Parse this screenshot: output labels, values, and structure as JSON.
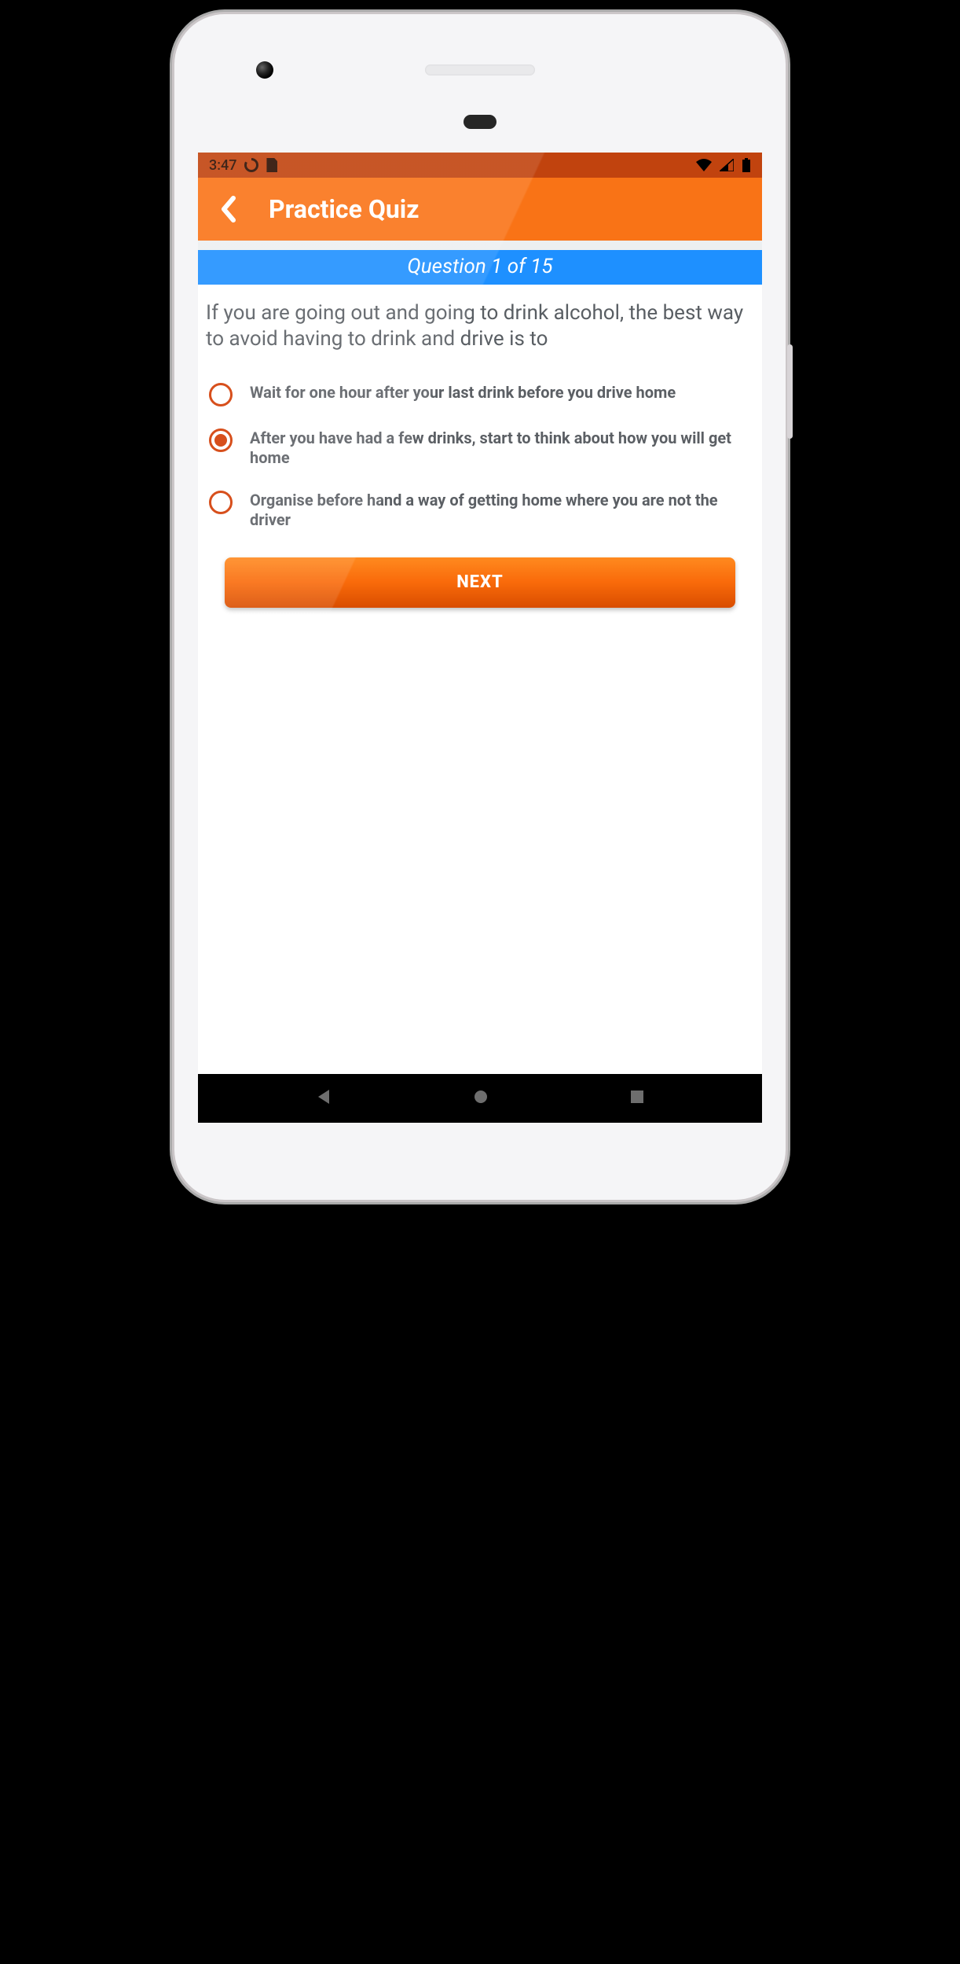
{
  "statusbar": {
    "time": "3:47"
  },
  "appbar": {
    "title": "Practice Quiz"
  },
  "question_header": "Question 1 of 15",
  "question_text": "If you are going out and going to drink alcohol, the best way to avoid having to drink and drive is to",
  "options": [
    {
      "label": "Wait for one hour after your last drink before you drive home",
      "selected": false
    },
    {
      "label": "After you have had a few drinks, start to think about how you will get home",
      "selected": true
    },
    {
      "label": "Organise before hand a way of getting home where you are not the driver",
      "selected": false
    }
  ],
  "next_button": "NEXT",
  "colors": {
    "accent": "#f97316",
    "accent_dark": "#c1430e",
    "blue": "#1e90ff",
    "radio": "#d33b02"
  }
}
